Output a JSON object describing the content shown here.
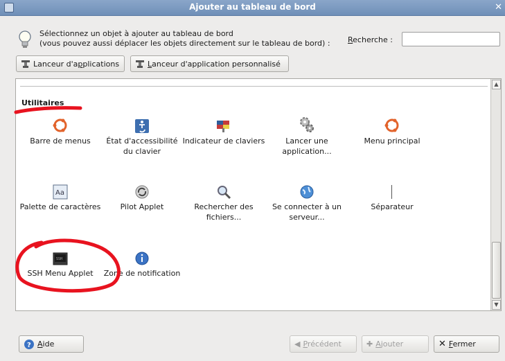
{
  "window": {
    "title": "Ajouter au tableau de bord"
  },
  "hint": {
    "line1": "Sélectionnez un objet à ajouter au tableau de bord",
    "line2": "(vous pouvez aussi déplacer les objets directement sur le tableau de bord) :"
  },
  "search": {
    "label_prefix": "",
    "label_mnemonic": "R",
    "label_rest": "echerche :",
    "value": ""
  },
  "launchers": {
    "app_button": {
      "pre": "Lanceur d'a",
      "mn": "p",
      "post": "plications"
    },
    "custom_button": {
      "pre": "",
      "mn": "L",
      "post": "anceur d'application personnalisé"
    }
  },
  "category": {
    "label": "Utilitaires"
  },
  "items": [
    {
      "label": "Barre de menus",
      "icon": "ubuntu-logo-icon"
    },
    {
      "label": "État d'accessibilité du clavier",
      "icon": "accessibility-icon"
    },
    {
      "label": "Indicateur de claviers",
      "icon": "keyboard-flag-icon"
    },
    {
      "label": "Lancer une application...",
      "icon": "gears-icon"
    },
    {
      "label": "Menu principal",
      "icon": "ubuntu-logo-icon"
    },
    {
      "label": "Palette de caractères",
      "icon": "character-map-icon"
    },
    {
      "label": "Pilot Applet",
      "icon": "refresh-icon"
    },
    {
      "label": "Rechercher des fichiers...",
      "icon": "magnifier-icon"
    },
    {
      "label": "Se connecter à un serveur...",
      "icon": "globe-icon"
    },
    {
      "label": "Séparateur",
      "icon": "separator-icon"
    },
    {
      "label": "SSH Menu Applet",
      "icon": "terminal-icon"
    },
    {
      "label": "Zone de notification",
      "icon": "info-icon"
    }
  ],
  "footer": {
    "help": {
      "pre": "",
      "mn": "A",
      "post": "ide"
    },
    "previous": {
      "pre": "",
      "mn": "P",
      "post": "récédent"
    },
    "add": {
      "pre": "",
      "mn": "A",
      "post": "jouter"
    },
    "close": {
      "pre": "",
      "mn": "F",
      "post": "ermer"
    }
  },
  "annotation_color": "#e8131f"
}
